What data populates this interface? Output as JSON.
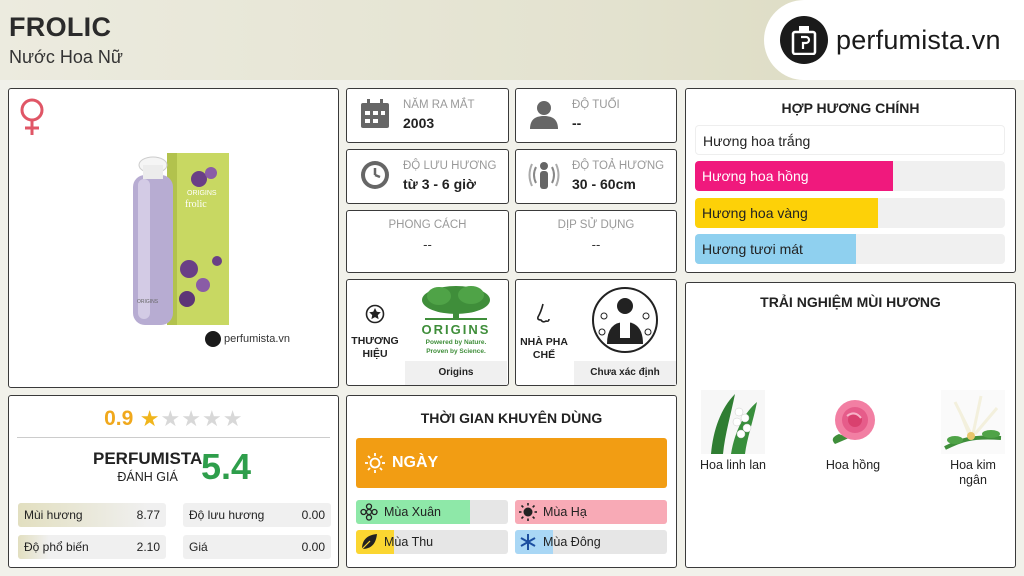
{
  "header": {
    "title": "FROLIC",
    "subtitle": "Nước Hoa Nữ",
    "site": "perfumista.vn"
  },
  "product": {
    "gender_icon": "female-symbol-icon",
    "watermark": "perfumista.vn"
  },
  "info": {
    "year_label": "NĂM RA MẮT",
    "year": "2003",
    "age_label": "ĐỘ TUỔI",
    "age": "--",
    "longevity_label": "ĐỘ LƯU HƯƠNG",
    "longevity": "từ 3 - 6 giờ",
    "sillage_label": "ĐỘ TOẢ HƯƠNG",
    "sillage": "30 - 60cm",
    "style_label": "PHONG CÁCH",
    "style": "--",
    "occasion_label": "DỊP SỬ DỤNG",
    "occasion": "--",
    "brand_label": "THƯƠNG HIỆU",
    "brand": "Origins",
    "brand_logo_title": "ORIGINS",
    "brand_logo_line1": "Powered by Nature.",
    "brand_logo_line2": "Proven by Science.",
    "perfumer_label": "NHÀ PHA CHẾ",
    "perfumer": "Chưa xác định"
  },
  "accords": {
    "title": "HỢP HƯƠNG CHÍNH",
    "items": [
      {
        "label": "Hương hoa trắng",
        "level": 0,
        "color": "#ffffff",
        "text_color": "#222222"
      },
      {
        "label": "Hương hoa hồng",
        "level": 0.64,
        "color": "#f0197d",
        "text_color": "#ffffff"
      },
      {
        "label": "Hương hoa vàng",
        "level": 0.59,
        "color": "#fdd108",
        "text_color": "#222222"
      },
      {
        "label": "Hương tươi mát",
        "level": 0.52,
        "color": "#8fd0ef",
        "text_color": "#222222"
      }
    ]
  },
  "rating": {
    "score": "0.9",
    "stars_filled": 1,
    "stars_total": 5,
    "pf_name": "PERFUMISTA",
    "pf_sub": "ĐÁNH GIÁ",
    "pf_score": "5.4",
    "metrics": [
      {
        "label": "Mùi hương",
        "value": "8.77",
        "level": 0.88
      },
      {
        "label": "Độ lưu hương",
        "value": "0.00",
        "level": 0
      },
      {
        "label": "Độ phổ biến",
        "value": "2.10",
        "level": 0.21
      },
      {
        "label": "Giá",
        "value": "0.00",
        "level": 0
      }
    ]
  },
  "time": {
    "title": "THỜI GIAN KHUYÊN DÙNG",
    "day_label": "NGÀY",
    "seasons": [
      {
        "label": "Mùa Xuân",
        "level": 0.75,
        "color": "#8ee8a8",
        "icon": "flower-icon"
      },
      {
        "label": "Mùa Hạ",
        "level": 1.0,
        "color": "#f8aab6",
        "icon": "sun-icon"
      },
      {
        "label": "Mùa Thu",
        "level": 0.25,
        "color": "#fbd631",
        "icon": "leaf-icon"
      },
      {
        "label": "Mùa Đông",
        "level": 0.25,
        "color": "#a9d7f5",
        "icon": "snowflake-icon"
      }
    ]
  },
  "notes": {
    "title": "TRẢI NGHIỆM MÙI HƯƠNG",
    "items": [
      {
        "label": "Hoa linh lan"
      },
      {
        "label": "Hoa hồng"
      },
      {
        "label": "Hoa kim ngân"
      }
    ]
  },
  "colors": {
    "star_filled": "#f0b51c",
    "star_empty": "#d8d8d8",
    "pf_score": "#2e9e4b",
    "day_bar": "#f29d13"
  }
}
